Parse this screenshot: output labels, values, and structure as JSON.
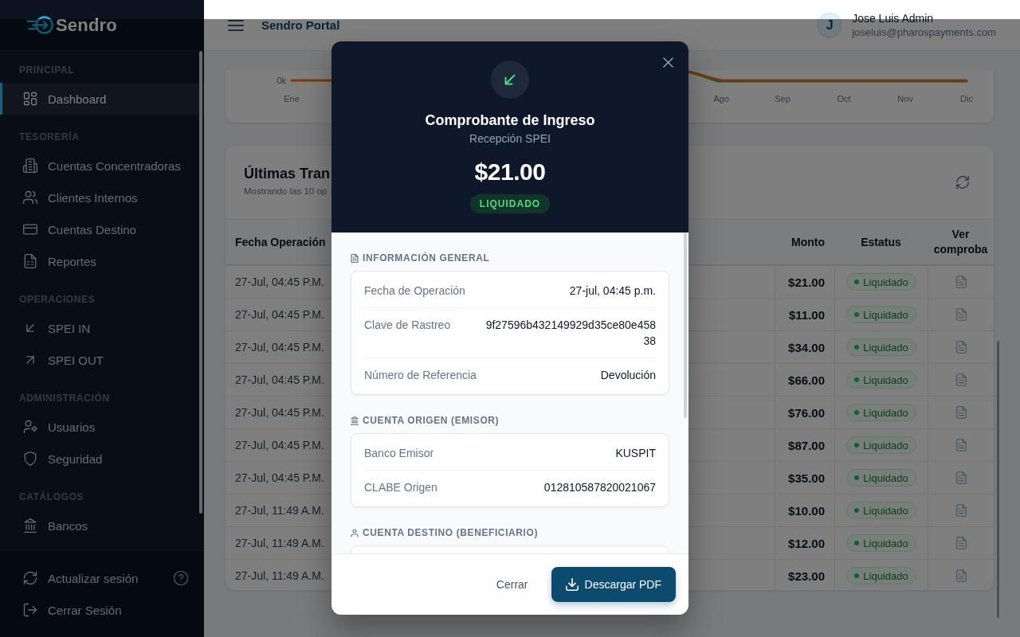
{
  "sidebar": {
    "logo": "Sendro",
    "sections": [
      {
        "title": "PRINCIPAL",
        "items": [
          {
            "label": "Dashboard",
            "selected": true
          }
        ]
      },
      {
        "title": "TESORERÍA",
        "items": [
          {
            "label": "Cuentas Concentradoras",
            "selected": false
          },
          {
            "label": "Clientes Internos",
            "selected": false
          },
          {
            "label": "Cuentas Destino",
            "selected": false
          },
          {
            "label": "Reportes",
            "selected": false
          }
        ]
      },
      {
        "title": "OPERACIONES",
        "items": [
          {
            "label": "SPEI IN",
            "selected": false
          },
          {
            "label": "SPEI OUT",
            "selected": false
          }
        ]
      },
      {
        "title": "ADMINISTRACIÓN",
        "items": [
          {
            "label": "Usuarios",
            "selected": false
          },
          {
            "label": "Seguridad",
            "selected": false
          }
        ]
      },
      {
        "title": "CATÁLOGOS",
        "items": [
          {
            "label": "Bancos",
            "selected": false
          }
        ]
      }
    ],
    "footer_items": [
      {
        "label": "Actualizar sesión"
      },
      {
        "label": "Cerrar Sesión"
      }
    ]
  },
  "header": {
    "title": "Sendro Portal",
    "user": {
      "initial": "J",
      "name": "Jose Luis Admin",
      "email": "joseluis@pharospayments.com"
    }
  },
  "chart": {
    "y_tick_label": "0k",
    "x_labels": [
      "Ene",
      "Ago",
      "Sep",
      "Oct",
      "Nov",
      "Dic"
    ]
  },
  "transactions": {
    "title": "Últimas Tran",
    "subtitle": "Mostrando las 10 op",
    "columns": [
      "Fecha Operación",
      "Monto",
      "Estatus",
      "Ver comproba"
    ],
    "rows": [
      {
        "date": "27-Jul, 04:45 P.M.",
        "amount": "$21.00",
        "status": "Liquidado"
      },
      {
        "date": "27-Jul, 04:45 P.M.",
        "amount": "$11.00",
        "status": "Liquidado"
      },
      {
        "date": "27-Jul, 04:45 P.M.",
        "amount": "$34.00",
        "status": "Liquidado"
      },
      {
        "date": "27-Jul, 04:45 P.M.",
        "amount": "$66.00",
        "status": "Liquidado"
      },
      {
        "date": "27-Jul, 04:45 P.M.",
        "amount": "$76.00",
        "status": "Liquidado"
      },
      {
        "date": "27-Jul, 04:45 P.M.",
        "amount": "$87.00",
        "status": "Liquidado"
      },
      {
        "date": "27-Jul, 04:45 P.M.",
        "amount": "$35.00",
        "status": "Liquidado"
      },
      {
        "date": "27-Jul, 11:49 A.M.",
        "amount": "$10.00",
        "status": "Liquidado"
      },
      {
        "date": "27-Jul, 11:49 A.M.",
        "amount": "$12.00",
        "status": "Liquidado"
      },
      {
        "date": "27-Jul, 11:49 A.M.",
        "amount": "$23.00",
        "status": "Liquidado"
      }
    ]
  },
  "receipt_modal": {
    "title": "Comprobante de Ingreso",
    "subtitle": "Recepción SPEI",
    "amount": "$21.00",
    "status": "LIQUIDADO",
    "sections": [
      {
        "title": "INFORMACIÓN GENERAL",
        "rows": [
          {
            "label": "Fecha de Operación",
            "value": "27-jul, 04:45 p.m."
          },
          {
            "label": "Clave de Rastreo",
            "value": "9f27596b432149929d35ce80e45838"
          },
          {
            "label": "Número de Referencia",
            "value": "Devolución"
          }
        ]
      },
      {
        "title": "CUENTA ORIGEN (EMISOR)",
        "rows": [
          {
            "label": "Banco Emisor",
            "value": "KUSPIT"
          },
          {
            "label": "CLABE Origen",
            "value": "012810587820021067"
          }
        ]
      },
      {
        "title": "CUENTA DESTINO (BENEFICIARIO)"
      }
    ],
    "buttons": [
      {
        "label": "Cerrar",
        "kind": "text"
      },
      {
        "label": "Descargar PDF",
        "kind": "primary"
      }
    ]
  }
}
